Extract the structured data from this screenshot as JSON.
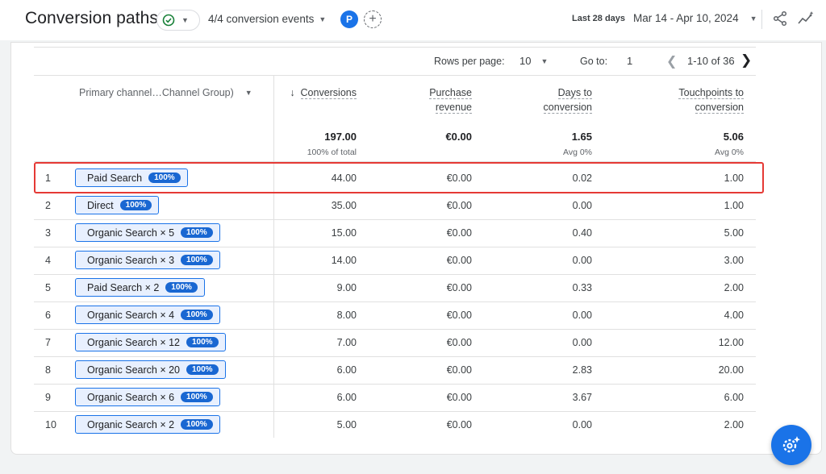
{
  "header": {
    "title": "Conversion paths",
    "events_label": "4/4 conversion events",
    "avatar_letter": "P",
    "add_compare": "+",
    "date_label": "Last 28 days",
    "date_range": "Mar 14 - Apr 10, 2024"
  },
  "pager": {
    "rows_per_page_label": "Rows per page:",
    "rows_per_page_value": "10",
    "goto_label": "Go to:",
    "goto_value": "1",
    "range_text": "1-10 of 36"
  },
  "table": {
    "dimension_header": "Primary channel…Channel Group)",
    "columns": [
      {
        "line1": "Conversions",
        "line2": "",
        "sort": "↓"
      },
      {
        "line1": "Purchase",
        "line2": "revenue"
      },
      {
        "line1": "Days to",
        "line2": "conversion"
      },
      {
        "line1": "Touchpoints to",
        "line2": "conversion"
      }
    ],
    "totals": {
      "conversions": "197.00",
      "conversions_sub": "100% of total",
      "revenue": "€0.00",
      "days": "1.65",
      "days_sub": "Avg 0%",
      "touchpoints": "5.06",
      "touchpoints_sub": "Avg 0%"
    },
    "rows": [
      {
        "idx": "1",
        "path": "Paid Search",
        "pct": "100%",
        "conv": "44.00",
        "rev": "€0.00",
        "days": "0.02",
        "touch": "1.00"
      },
      {
        "idx": "2",
        "path": "Direct",
        "pct": "100%",
        "conv": "35.00",
        "rev": "€0.00",
        "days": "0.00",
        "touch": "1.00"
      },
      {
        "idx": "3",
        "path": "Organic Search × 5",
        "pct": "100%",
        "conv": "15.00",
        "rev": "€0.00",
        "days": "0.40",
        "touch": "5.00"
      },
      {
        "idx": "4",
        "path": "Organic Search × 3",
        "pct": "100%",
        "conv": "14.00",
        "rev": "€0.00",
        "days": "0.00",
        "touch": "3.00"
      },
      {
        "idx": "5",
        "path": "Paid Search × 2",
        "pct": "100%",
        "conv": "9.00",
        "rev": "€0.00",
        "days": "0.33",
        "touch": "2.00"
      },
      {
        "idx": "6",
        "path": "Organic Search × 4",
        "pct": "100%",
        "conv": "8.00",
        "rev": "€0.00",
        "days": "0.00",
        "touch": "4.00"
      },
      {
        "idx": "7",
        "path": "Organic Search × 12",
        "pct": "100%",
        "conv": "7.00",
        "rev": "€0.00",
        "days": "0.00",
        "touch": "12.00"
      },
      {
        "idx": "8",
        "path": "Organic Search × 20",
        "pct": "100%",
        "conv": "6.00",
        "rev": "€0.00",
        "days": "2.83",
        "touch": "20.00"
      },
      {
        "idx": "9",
        "path": "Organic Search × 6",
        "pct": "100%",
        "conv": "6.00",
        "rev": "€0.00",
        "days": "3.67",
        "touch": "6.00"
      },
      {
        "idx": "10",
        "path": "Organic Search × 2",
        "pct": "100%",
        "conv": "5.00",
        "rev": "€0.00",
        "days": "0.00",
        "touch": "2.00"
      }
    ]
  },
  "icons": {
    "status": "check-circle-icon",
    "share": "share-icon",
    "insights": "insights-icon",
    "fab": "settings-sparkle-icon",
    "prev": "chevron-left-icon",
    "next": "chevron-right-icon"
  },
  "colors": {
    "accent": "#1a73e8",
    "check_green": "#188038",
    "highlight_border": "#e53935",
    "chip_bg": "#e8f0fe",
    "badge_bg": "#1967d2"
  }
}
